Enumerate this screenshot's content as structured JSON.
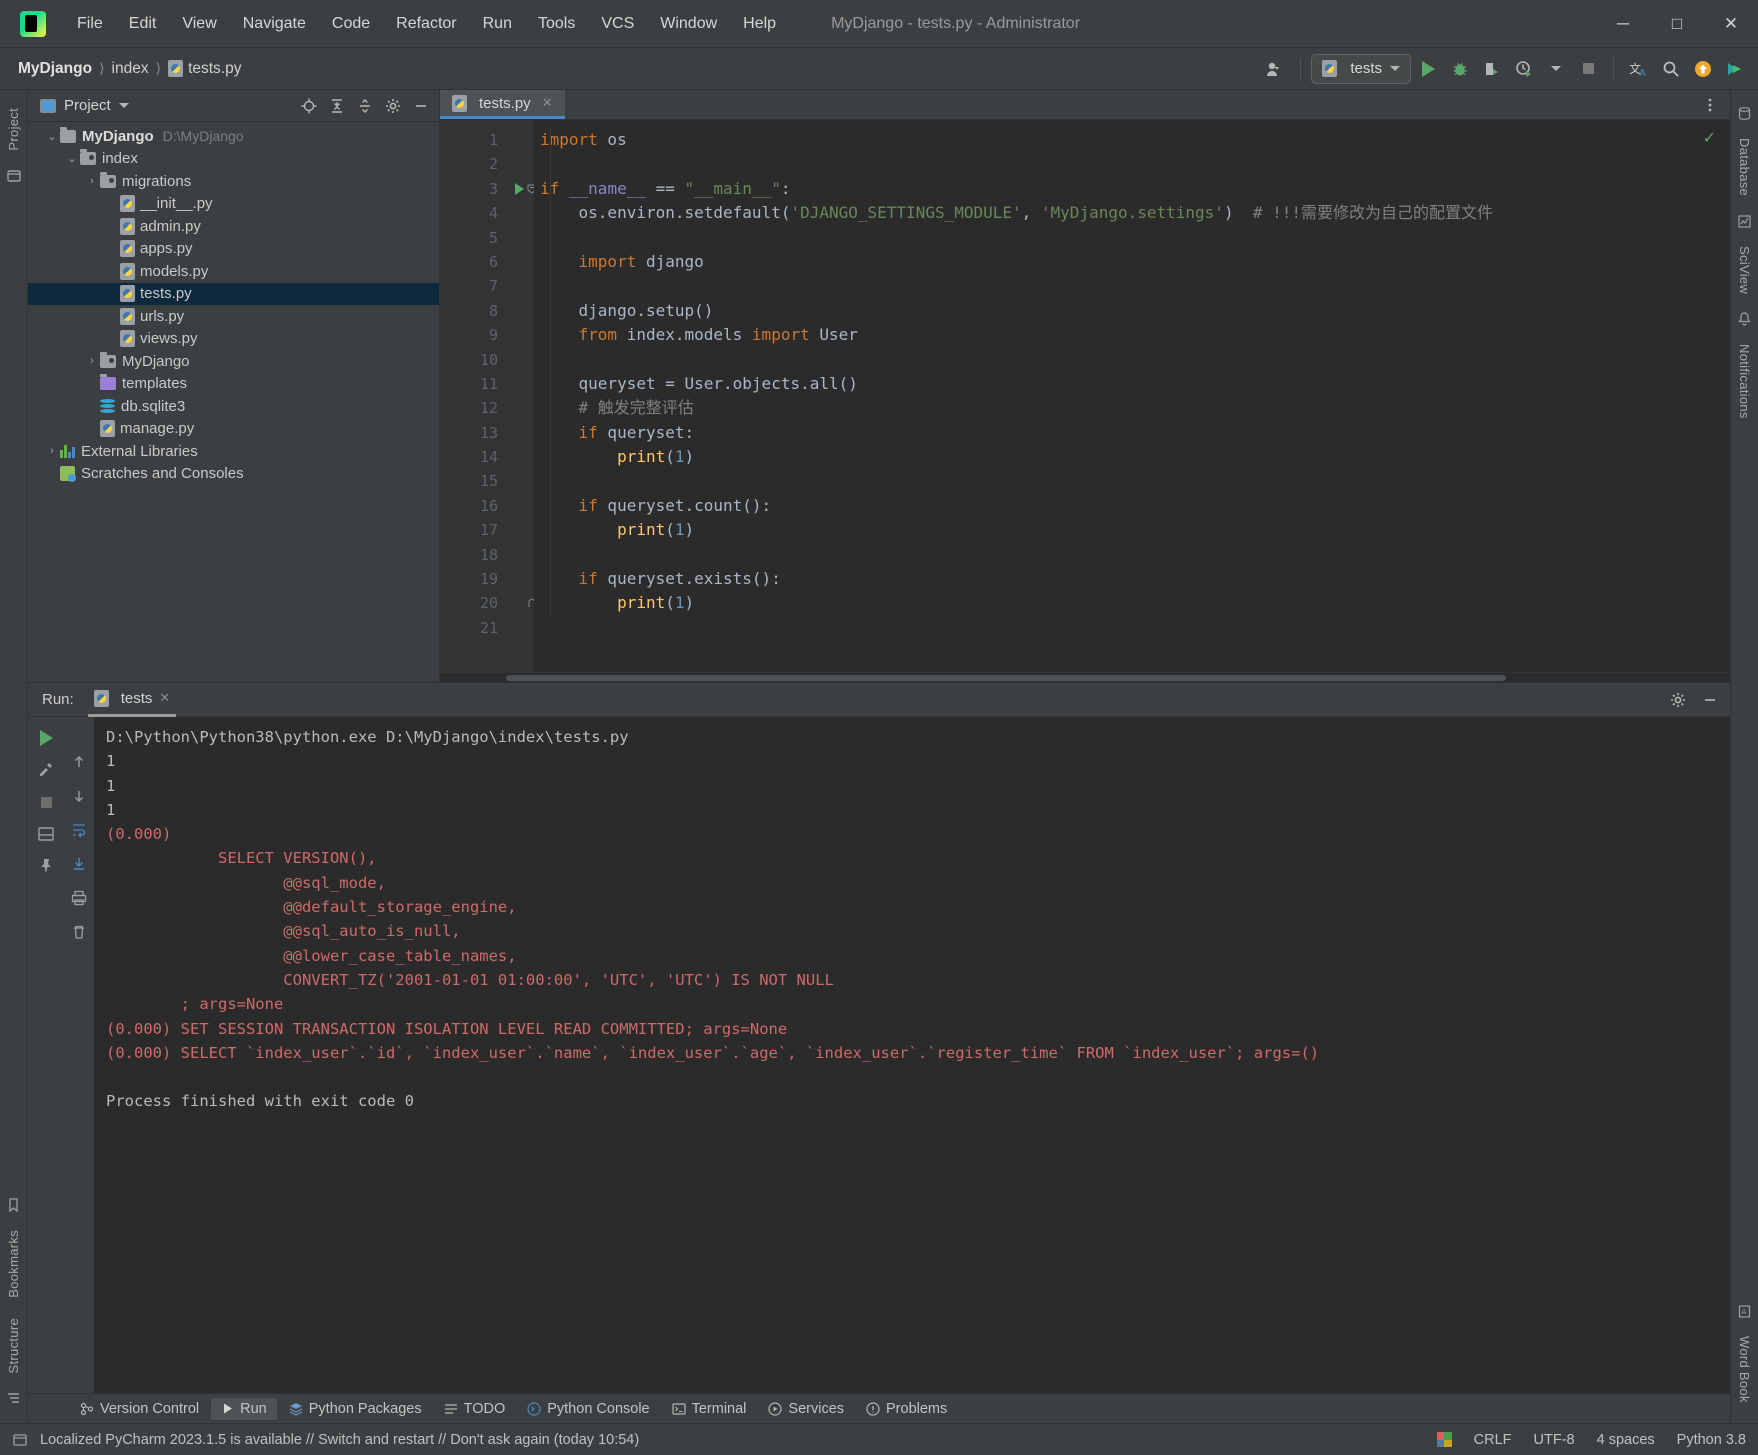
{
  "window": {
    "title": "MyDjango - tests.py - Administrator",
    "logo_text": "PC",
    "minimize": "─",
    "maximize": "□",
    "close": "✕"
  },
  "menubar": [
    {
      "label": "File"
    },
    {
      "label": "Edit"
    },
    {
      "label": "View"
    },
    {
      "label": "Navigate"
    },
    {
      "label": "Code"
    },
    {
      "label": "Refactor"
    },
    {
      "label": "Run"
    },
    {
      "label": "Tools"
    },
    {
      "label": "VCS"
    },
    {
      "label": "Window"
    },
    {
      "label": "Help"
    }
  ],
  "breadcrumbs": [
    {
      "label": "MyDjango",
      "bold": true
    },
    {
      "label": "index",
      "bold": false
    },
    {
      "label": "tests.py",
      "bold": false
    }
  ],
  "toolbar": {
    "run_config": "tests",
    "run_icon": "run-icon",
    "debug_icon": "debug-icon",
    "coverage_icon": "coverage-icon",
    "profile_icon": "profile-icon",
    "stop_icon": "stop-icon",
    "translate_icon": "translate-icon",
    "search_icon": "search-icon",
    "update_icon": "update-icon",
    "plugin_icon": "plugin-icon",
    "account_icon": "account-icon"
  },
  "left_rail": [
    {
      "label": "Project"
    },
    {
      "label": "structure-icon"
    }
  ],
  "left_rail_bottom": [
    {
      "label": "Bookmarks"
    },
    {
      "label": "Structure"
    }
  ],
  "right_rail": [
    {
      "label": "Database"
    },
    {
      "label": "SciView"
    },
    {
      "label": "Notifications"
    }
  ],
  "right_rail_bottom": [
    {
      "label": "Word Book"
    }
  ],
  "project_panel": {
    "title": "Project",
    "actions": [
      "locate-icon",
      "expand-all-icon",
      "collapse-all-icon",
      "settings-icon",
      "hide-icon"
    ],
    "tree": [
      {
        "depth": 0,
        "arrow": "⌄",
        "icon": "folder",
        "label": "MyDjango",
        "bold": true,
        "path": "D:\\MyDjango",
        "selected": false
      },
      {
        "depth": 1,
        "arrow": "⌄",
        "icon": "folder-src",
        "label": "index",
        "bold": false,
        "path": "",
        "selected": false
      },
      {
        "depth": 2,
        "arrow": "›",
        "icon": "folder-src",
        "label": "migrations",
        "bold": false,
        "path": "",
        "selected": false
      },
      {
        "depth": 3,
        "arrow": "",
        "icon": "python",
        "label": "__init__.py",
        "bold": false,
        "path": "",
        "selected": false
      },
      {
        "depth": 3,
        "arrow": "",
        "icon": "python",
        "label": "admin.py",
        "bold": false,
        "path": "",
        "selected": false
      },
      {
        "depth": 3,
        "arrow": "",
        "icon": "python",
        "label": "apps.py",
        "bold": false,
        "path": "",
        "selected": false
      },
      {
        "depth": 3,
        "arrow": "",
        "icon": "python",
        "label": "models.py",
        "bold": false,
        "path": "",
        "selected": false
      },
      {
        "depth": 3,
        "arrow": "",
        "icon": "python",
        "label": "tests.py",
        "bold": false,
        "path": "",
        "selected": true
      },
      {
        "depth": 3,
        "arrow": "",
        "icon": "python",
        "label": "urls.py",
        "bold": false,
        "path": "",
        "selected": false
      },
      {
        "depth": 3,
        "arrow": "",
        "icon": "python",
        "label": "views.py",
        "bold": false,
        "path": "",
        "selected": false
      },
      {
        "depth": 2,
        "arrow": "›",
        "icon": "folder-src",
        "label": "MyDjango",
        "bold": false,
        "path": "",
        "selected": false
      },
      {
        "depth": 2,
        "arrow": "",
        "icon": "folder-tpl",
        "label": "templates",
        "bold": false,
        "path": "",
        "selected": false
      },
      {
        "depth": 2,
        "arrow": "",
        "icon": "db",
        "label": "db.sqlite3",
        "bold": false,
        "path": "",
        "selected": false
      },
      {
        "depth": 2,
        "arrow": "",
        "icon": "python",
        "label": "manage.py",
        "bold": false,
        "path": "",
        "selected": false
      },
      {
        "depth": 0,
        "arrow": "›",
        "icon": "lib",
        "label": "External Libraries",
        "bold": false,
        "path": "",
        "selected": false
      },
      {
        "depth": 0,
        "arrow": "",
        "icon": "scratch",
        "label": "Scratches and Consoles",
        "bold": false,
        "path": "",
        "selected": false
      }
    ]
  },
  "editor": {
    "tab_label": "tests.py",
    "tab_close": "✕",
    "inspection_ok": "✓",
    "lines": [
      {
        "n": 1,
        "runmark": false,
        "fold": "",
        "text": "import os",
        "type": "import"
      },
      {
        "n": 2,
        "runmark": false,
        "fold": "",
        "text": "",
        "type": "blank"
      },
      {
        "n": 3,
        "runmark": true,
        "fold": "minus",
        "text": "if __name__ == \"__main__\":",
        "type": "if_main"
      },
      {
        "n": 4,
        "runmark": false,
        "fold": "",
        "text": "    os.environ.setdefault('DJANGO_SETTINGS_MODULE', 'MyDjango.settings')  # !!!需要修改为自己的配置文件",
        "type": "setdefault"
      },
      {
        "n": 5,
        "runmark": false,
        "fold": "",
        "text": "",
        "type": "blank"
      },
      {
        "n": 6,
        "runmark": false,
        "fold": "",
        "text": "    import django",
        "type": "import2"
      },
      {
        "n": 7,
        "runmark": false,
        "fold": "",
        "text": "",
        "type": "blank"
      },
      {
        "n": 8,
        "runmark": false,
        "fold": "",
        "text": "    django.setup()",
        "type": "plain"
      },
      {
        "n": 9,
        "runmark": false,
        "fold": "",
        "text": "    from index.models import User",
        "type": "fromimport"
      },
      {
        "n": 10,
        "runmark": false,
        "fold": "",
        "text": "",
        "type": "blank"
      },
      {
        "n": 11,
        "runmark": false,
        "fold": "",
        "text": "    queryset = User.objects.all()",
        "type": "plain"
      },
      {
        "n": 12,
        "runmark": false,
        "fold": "",
        "text": "    # 触发完整评估",
        "type": "comment"
      },
      {
        "n": 13,
        "runmark": false,
        "fold": "",
        "text": "    if queryset:",
        "type": "if"
      },
      {
        "n": 14,
        "runmark": false,
        "fold": "",
        "text": "        print(1)",
        "type": "print"
      },
      {
        "n": 15,
        "runmark": false,
        "fold": "",
        "text": "",
        "type": "blank"
      },
      {
        "n": 16,
        "runmark": false,
        "fold": "",
        "text": "    if queryset.count():",
        "type": "if"
      },
      {
        "n": 17,
        "runmark": false,
        "fold": "",
        "text": "        print(1)",
        "type": "print"
      },
      {
        "n": 18,
        "runmark": false,
        "fold": "",
        "text": "",
        "type": "blank"
      },
      {
        "n": 19,
        "runmark": false,
        "fold": "",
        "text": "    if queryset.exists():",
        "type": "if"
      },
      {
        "n": 20,
        "runmark": false,
        "fold": "end",
        "text": "        print(1)",
        "type": "print"
      },
      {
        "n": 21,
        "runmark": false,
        "fold": "",
        "text": "",
        "type": "blank"
      }
    ]
  },
  "run_panel": {
    "label": "Run:",
    "tab": "tests",
    "tab_close": "✕",
    "actions": [
      "settings-icon",
      "hide-icon"
    ],
    "toolbar": [
      "rerun-icon",
      "wrench-icon",
      "stop-icon",
      "layout-icon",
      "pin-icon"
    ],
    "toolbar2": [
      "up-icon",
      "down-icon",
      "soft-wrap-icon",
      "scroll-end-icon",
      "print-icon",
      "trash-icon"
    ],
    "console": [
      {
        "text": "D:\\Python\\Python38\\python.exe D:\\MyDjango\\index\\tests.py",
        "err": false
      },
      {
        "text": "1",
        "err": false
      },
      {
        "text": "1",
        "err": false
      },
      {
        "text": "1",
        "err": false
      },
      {
        "text": "(0.000)",
        "err": true
      },
      {
        "text": "            SELECT VERSION(),",
        "err": true
      },
      {
        "text": "                   @@sql_mode,",
        "err": true
      },
      {
        "text": "                   @@default_storage_engine,",
        "err": true
      },
      {
        "text": "                   @@sql_auto_is_null,",
        "err": true
      },
      {
        "text": "                   @@lower_case_table_names,",
        "err": true
      },
      {
        "text": "                   CONVERT_TZ('2001-01-01 01:00:00', 'UTC', 'UTC') IS NOT NULL",
        "err": true
      },
      {
        "text": "        ; args=None",
        "err": true
      },
      {
        "text": "(0.000) SET SESSION TRANSACTION ISOLATION LEVEL READ COMMITTED; args=None",
        "err": true
      },
      {
        "text": "(0.000) SELECT `index_user`.`id`, `index_user`.`name`, `index_user`.`age`, `index_user`.`register_time` FROM `index_user`; args=()",
        "err": true
      },
      {
        "text": "",
        "err": false
      },
      {
        "text": "Process finished with exit code 0",
        "err": false
      }
    ]
  },
  "bottom_tabs": [
    {
      "label": "Version Control",
      "icon": "vcs-icon",
      "active": false
    },
    {
      "label": "Run",
      "icon": "run-icon",
      "active": true
    },
    {
      "label": "Python Packages",
      "icon": "packages-icon",
      "active": false
    },
    {
      "label": "TODO",
      "icon": "todo-icon",
      "active": false
    },
    {
      "label": "Python Console",
      "icon": "python-console-icon",
      "active": false
    },
    {
      "label": "Terminal",
      "icon": "terminal-icon",
      "active": false
    },
    {
      "label": "Services",
      "icon": "services-icon",
      "active": false
    },
    {
      "label": "Problems",
      "icon": "problems-icon",
      "active": false
    }
  ],
  "statusbar": {
    "message": "Localized PyCharm 2023.1.5 is available // Switch and restart // Don't ask again (today 10:54)",
    "line_sep": "CRLF",
    "encoding": "UTF-8",
    "indent": "4 spaces",
    "interpreter": "Python 3.8"
  },
  "colors": {
    "accent": "#4a88c7",
    "green": "#59a869",
    "error": "#cf6a6a",
    "selection": "#0d293e",
    "editor_bg": "#2b2b2b",
    "panel_bg": "#3c3f41"
  }
}
